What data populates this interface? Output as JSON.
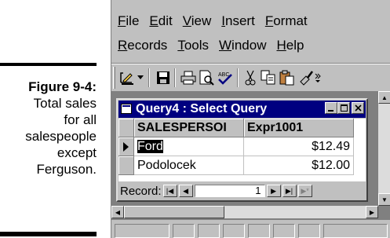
{
  "caption": {
    "figure_label": "Figure 9-4:",
    "lines": [
      "Total sales",
      "for all",
      "salespeople",
      "except",
      "Ferguson."
    ]
  },
  "menu": {
    "row1": [
      "File",
      "Edit",
      "View",
      "Insert",
      "Format"
    ],
    "row2": [
      "Records",
      "Tools",
      "Window",
      "Help"
    ]
  },
  "toolbar": {
    "icons": [
      "design-view-icon",
      "dropdown-arrow-icon",
      "save-icon",
      "print-icon",
      "print-preview-icon",
      "spelling-icon",
      "cut-icon",
      "copy-icon",
      "paste-icon",
      "format-painter-icon"
    ]
  },
  "query_window": {
    "title": "Query4 : Select Query",
    "controls": [
      "minimize-icon",
      "restore-icon",
      "close-icon"
    ],
    "columns": [
      "SALESPERSOI",
      "Expr1001"
    ],
    "rows": [
      {
        "salesperson": "Ford",
        "expr": "$12.49",
        "current": true
      },
      {
        "salesperson": "Podolocek",
        "expr": "$12.00",
        "current": false
      }
    ],
    "record_nav": {
      "label": "Record:",
      "current": "1"
    }
  }
}
